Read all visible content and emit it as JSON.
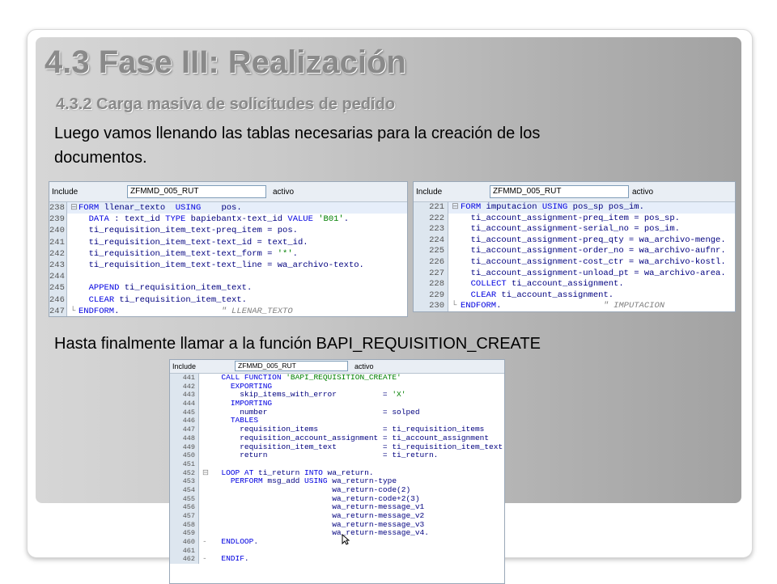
{
  "slide": {
    "title": "4.3 Fase III: Realización",
    "subtitle": "4.3.2 Carga masiva de solicitudes de pedido",
    "paragraph_line1": "Luego vamos llenando las tablas necesarias para la creación de los",
    "paragraph_line2": "documentos.",
    "paragraph2": "Hasta finalmente llamar a la función BAPI_REQUISITION_CREATE"
  },
  "editor_header": {
    "include_label": "Include",
    "program": "ZFMMD_005_RUT",
    "status": "activo"
  },
  "code_a": [
    {
      "n": "238",
      "g": "⊟",
      "t": "FORM llenar_texto  USING    pos."
    },
    {
      "n": "239",
      "g": "",
      "t": "  DATA : text_id TYPE bapiebantx-text_id VALUE 'B01'."
    },
    {
      "n": "240",
      "g": "",
      "t": "  ti_requisition_item_text-preq_item = pos."
    },
    {
      "n": "241",
      "g": "",
      "t": "  ti_requisition_item_text-text_id = text_id."
    },
    {
      "n": "242",
      "g": "",
      "t": "  ti_requisition_item_text-text_form = '*'."
    },
    {
      "n": "243",
      "g": "",
      "t": "  ti_requisition_item_text-text_line = wa_archivo-texto."
    },
    {
      "n": "244",
      "g": "",
      "t": ""
    },
    {
      "n": "245",
      "g": "",
      "t": "  APPEND ti_requisition_item_text."
    },
    {
      "n": "246",
      "g": "",
      "t": "  CLEAR ti_requisition_item_text."
    },
    {
      "n": "247",
      "g": "└",
      "t": "ENDFORM.                    \" LLENAR_TEXTO"
    }
  ],
  "code_b": [
    {
      "n": "221",
      "g": "⊟",
      "t": "FORM imputacion USING pos_sp pos_im."
    },
    {
      "n": "222",
      "g": "",
      "t": "  ti_account_assignment-preq_item = pos_sp."
    },
    {
      "n": "223",
      "g": "",
      "t": "  ti_account_assignment-serial_no = pos_im."
    },
    {
      "n": "224",
      "g": "",
      "t": "  ti_account_assignment-preq_qty = wa_archivo-menge."
    },
    {
      "n": "225",
      "g": "",
      "t": "  ti_account_assignment-order_no = wa_archivo-aufnr."
    },
    {
      "n": "226",
      "g": "",
      "t": "  ti_account_assignment-cost_ctr = wa_archivo-kostl."
    },
    {
      "n": "227",
      "g": "",
      "t": "  ti_account_assignment-unload_pt = wa_archivo-area."
    },
    {
      "n": "228",
      "g": "",
      "t": "  COLLECT ti_account_assignment."
    },
    {
      "n": "229",
      "g": "",
      "t": "  CLEAR ti_account_assignment."
    },
    {
      "n": "230",
      "g": "└",
      "t": "ENDFORM.                    \" IMPUTACION"
    }
  ],
  "code_c": [
    {
      "n": "441",
      "g": "",
      "t": "  CALL FUNCTION 'BAPI_REQUISITION_CREATE'"
    },
    {
      "n": "442",
      "g": "",
      "t": "    EXPORTING"
    },
    {
      "n": "443",
      "g": "",
      "t": "      skip_items_with_error          = 'X'"
    },
    {
      "n": "444",
      "g": "",
      "t": "    IMPORTING"
    },
    {
      "n": "445",
      "g": "",
      "t": "      number                         = solped"
    },
    {
      "n": "446",
      "g": "",
      "t": "    TABLES"
    },
    {
      "n": "447",
      "g": "",
      "t": "      requisition_items              = ti_requisition_items"
    },
    {
      "n": "448",
      "g": "",
      "t": "      requisition_account_assignment = ti_account_assignment"
    },
    {
      "n": "449",
      "g": "",
      "t": "      requisition_item_text          = ti_requisition_item_text"
    },
    {
      "n": "450",
      "g": "",
      "t": "      return                         = ti_return."
    },
    {
      "n": "451",
      "g": "",
      "t": ""
    },
    {
      "n": "452",
      "g": "⊟",
      "t": "  LOOP AT ti_return INTO wa_return."
    },
    {
      "n": "453",
      "g": "",
      "t": "    PERFORM msg_add USING wa_return-type"
    },
    {
      "n": "454",
      "g": "",
      "t": "                          wa_return-code(2)"
    },
    {
      "n": "455",
      "g": "",
      "t": "                          wa_return-code+2(3)"
    },
    {
      "n": "456",
      "g": "",
      "t": "                          wa_return-message_v1"
    },
    {
      "n": "457",
      "g": "",
      "t": "                          wa_return-message_v2"
    },
    {
      "n": "458",
      "g": "",
      "t": "                          wa_return-message_v3"
    },
    {
      "n": "459",
      "g": "",
      "t": "                          wa_return-message_v4."
    },
    {
      "n": "460",
      "g": "-",
      "t": "  ENDLOOP."
    },
    {
      "n": "461",
      "g": "",
      "t": ""
    },
    {
      "n": "462",
      "g": "-",
      "t": "  ENDIF."
    }
  ],
  "colors": {
    "title_gray": "#8a8a8a",
    "keyword_blue": "#0000e0",
    "string_green": "#007f00",
    "linenum_bg": "#dde6ef"
  }
}
